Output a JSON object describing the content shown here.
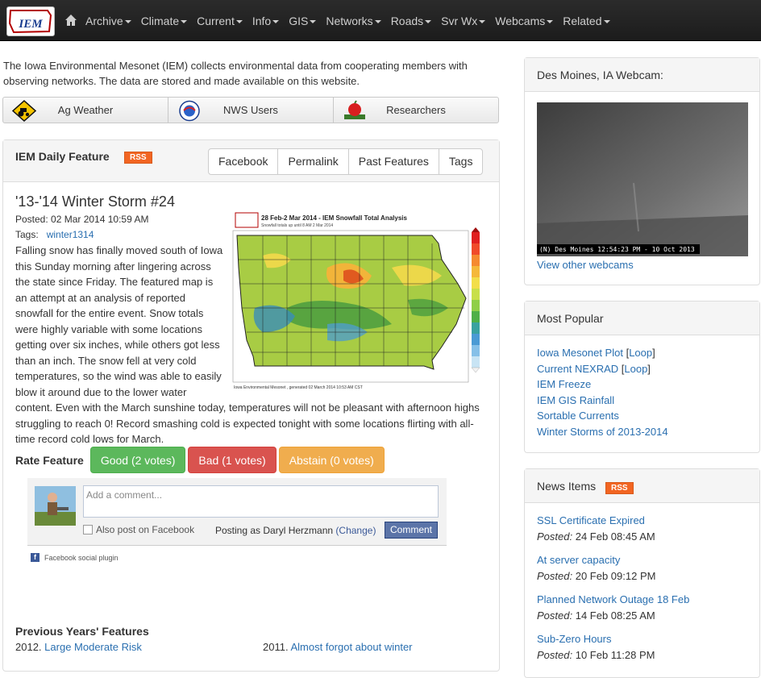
{
  "navbar": {
    "logo_text": "IEM",
    "items": [
      {
        "label": "Archive"
      },
      {
        "label": "Climate"
      },
      {
        "label": "Current"
      },
      {
        "label": "Info"
      },
      {
        "label": "GIS"
      },
      {
        "label": "Networks"
      },
      {
        "label": "Roads"
      },
      {
        "label": "Svr Wx"
      },
      {
        "label": "Webcams"
      },
      {
        "label": "Related"
      }
    ]
  },
  "intro": {
    "text": "The Iowa Environmental Mesonet (IEM) collects environmental data from cooperating members with observing networks. The data are stored and made available on this website."
  },
  "audience": [
    {
      "label": "Ag Weather",
      "icon": "tractor-sign-icon"
    },
    {
      "label": "NWS Users",
      "icon": "nws-logo-icon"
    },
    {
      "label": "Researchers",
      "icon": "apple-book-icon"
    }
  ],
  "feature": {
    "panel_title": "IEM Daily Feature",
    "rss_label": "RSS",
    "buttons": [
      "Facebook",
      "Permalink",
      "Past Features",
      "Tags"
    ],
    "title": "'13-'14 Winter Storm #24",
    "posted": "Posted: 02 Mar 2014 10:59 AM",
    "tags_label": "Tags:",
    "tag": "winter1314",
    "body": "Falling snow has finally moved south of Iowa this Sunday morning after lingering across the state since Friday. The featured map is an attempt at an analysis of reported snowfall for the entire event. Snow totals were highly variable with some locations getting over six inches, while others got less than an inch. The snow fell at very cold temperatures, so the wind was able to easily blow it around due to the lower water content. Even with the March sunshine today, temperatures will not be pleasant with afternoon highs struggling to reach 0! Record smashing cold is expected tonight with some locations flirting with all-time record cold lows for March.",
    "map": {
      "title": "28 Feb-2 Mar 2014 - IEM Snowfall Total Analysis",
      "subtitle": "Snowfall totals up until 8 AM 2 Mar 2014",
      "footer": "Iowa Environmental Mesonet , generated 02 March 2014 10:53 AM CST"
    },
    "rate": {
      "label": "Rate Feature",
      "good": "Good (2 votes)",
      "bad": "Bad (1 votes)",
      "abstain": "Abstain (0 votes)"
    }
  },
  "facebook": {
    "placeholder": "Add a comment...",
    "also_post": "Also post on Facebook",
    "posting_as": "Posting as Daryl Herzmann",
    "change": "(Change)",
    "comment_button": "Comment",
    "plugin": "Facebook social plugin"
  },
  "previous": {
    "title": "Previous Years' Features",
    "items": [
      {
        "year": "2012.",
        "title": "Large Moderate Risk"
      },
      {
        "year": "2011.",
        "title": "Almost forgot about winter"
      }
    ]
  },
  "webcam_panel": {
    "title": "Des Moines, IA Webcam:",
    "timestamp": "(N) Des Moines 12:54:23 PM - 10 Oct 2013",
    "link": "View other webcams"
  },
  "popular": {
    "title": "Most Popular",
    "items": [
      {
        "label": "Iowa Mesonet Plot",
        "extra": "Loop"
      },
      {
        "label": "Current NEXRAD",
        "extra": "Loop"
      },
      {
        "label": "IEM Freeze"
      },
      {
        "label": "IEM GIS Rainfall"
      },
      {
        "label": "Sortable Currents"
      },
      {
        "label": "Winter Storms of 2013-2014"
      }
    ]
  },
  "news": {
    "title": "News Items",
    "rss_label": "RSS",
    "posted_label": "Posted:",
    "items": [
      {
        "title": "SSL Certificate Expired",
        "date": "24 Feb 08:45 AM"
      },
      {
        "title": "At server capacity",
        "date": "20 Feb 09:12 PM"
      },
      {
        "title": "Planned Network Outage 18 Feb",
        "date": "14 Feb 08:25 AM"
      },
      {
        "title": "Sub-Zero Hours",
        "date": "10 Feb 11:28 PM"
      }
    ]
  },
  "colors": {
    "navbar": "#222222",
    "link": "#2a6fb0",
    "rss": "#f26522",
    "good": "#5cb85c",
    "bad": "#d9534f",
    "abstain": "#f0ad4e"
  }
}
